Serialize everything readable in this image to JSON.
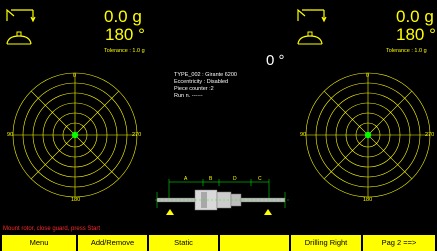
{
  "left_panel": {
    "weight": "0.0 g",
    "angle": "180 °",
    "tolerance": "Tolerance : 1.0 g",
    "polar_labels": {
      "top": "0",
      "right": "270",
      "bottom": "180",
      "left": "90"
    }
  },
  "right_panel": {
    "weight": "0.0 g",
    "angle": "180 °",
    "tolerance": "Tolerance : 1.0 g",
    "polar_labels": {
      "top": "0",
      "right": "270",
      "bottom": "180",
      "left": "90"
    }
  },
  "center": {
    "angle": "0 °",
    "info_lines": [
      "TYPE_002 : Girante 6200",
      "Eccentricity : Disabled",
      "Piece counter :2",
      "Run n. ------"
    ],
    "dimension_labels": [
      "A",
      "B",
      "D",
      "C"
    ]
  },
  "status_message": "Mount rotor, close guard, press Start",
  "buttons": [
    {
      "label": "Menu"
    },
    {
      "label": "Add/Remove"
    },
    {
      "label": "Static"
    },
    {
      "label": ""
    },
    {
      "label": "Drilling Right"
    },
    {
      "label": "Pag 2 ==>"
    }
  ],
  "colors": {
    "primary": "#ffff00",
    "target_dot": "#00ff00",
    "status_text": "#ff2a2a",
    "info_text": "#ffffff",
    "background": "#000000"
  },
  "icons": {
    "top_left": "balancing-plane-icon",
    "mid_left": "bowl-tool-icon",
    "top_right": "balancing-plane-icon",
    "mid_right": "bowl-tool-icon"
  }
}
